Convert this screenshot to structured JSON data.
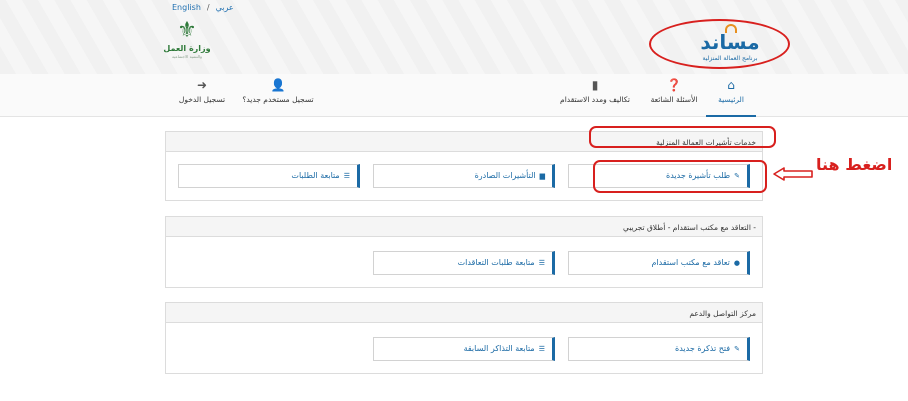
{
  "header": {
    "lang_english": "English",
    "lang_separator": "/",
    "lang_arabic": "عربي",
    "ministry_name": "وزارة العمل",
    "ministry_sub": "والتنمية الاجتماعية",
    "brand_name": "مساند",
    "brand_tagline": "برنامج العمالة المنزلية",
    "icons": {
      "ministry": "palm-tree-icon",
      "brand": "roof-icon"
    }
  },
  "nav": {
    "home": "الرئيسية",
    "faq": "الأسئلة الشائعة",
    "costs": "تكاليف ومدد الاستقدام",
    "register": "تسجيل مستخدم جديد؟",
    "login": "تسجيل الدخول",
    "icons": {
      "home": "home-icon",
      "faq": "question-circle-icon",
      "costs": "document-icon",
      "register": "user-plus-icon",
      "login": "login-icon"
    }
  },
  "sections": [
    {
      "title": "خدمات تأشيرات العمالة المنزلية",
      "buttons": [
        {
          "label": "طلب تأشيرة جديدة",
          "icon": "edit-icon",
          "glyph": "✎"
        },
        {
          "label": "التأشيرات الصادرة",
          "icon": "file-icon",
          "glyph": "▆"
        },
        {
          "label": "متابعة الطلبات",
          "icon": "list-icon",
          "glyph": "☰"
        }
      ]
    },
    {
      "title": "التعاقد مع مكتب استقدام - أطلاق تجريبي -",
      "buttons": [
        {
          "label": "تعاقد مع مكتب استقدام",
          "icon": "check-circle-icon",
          "glyph": "●"
        },
        {
          "label": "متابعة طلبات التعاقدات",
          "icon": "list-icon",
          "glyph": "☰"
        }
      ]
    },
    {
      "title": "مركز التواصل والدعم",
      "buttons": [
        {
          "label": "فتح تذكرة جديدة",
          "icon": "edit-icon",
          "glyph": "✎"
        },
        {
          "label": "متابعة التذاكر السابقة",
          "icon": "list-icon",
          "glyph": "☰"
        }
      ]
    }
  ],
  "annotation": {
    "hint": "اضغط هنا",
    "color": "#d8201e"
  },
  "colors": {
    "brand": "#1b6aa5",
    "accent": "#e7901f",
    "highlight": "#d8201e"
  }
}
